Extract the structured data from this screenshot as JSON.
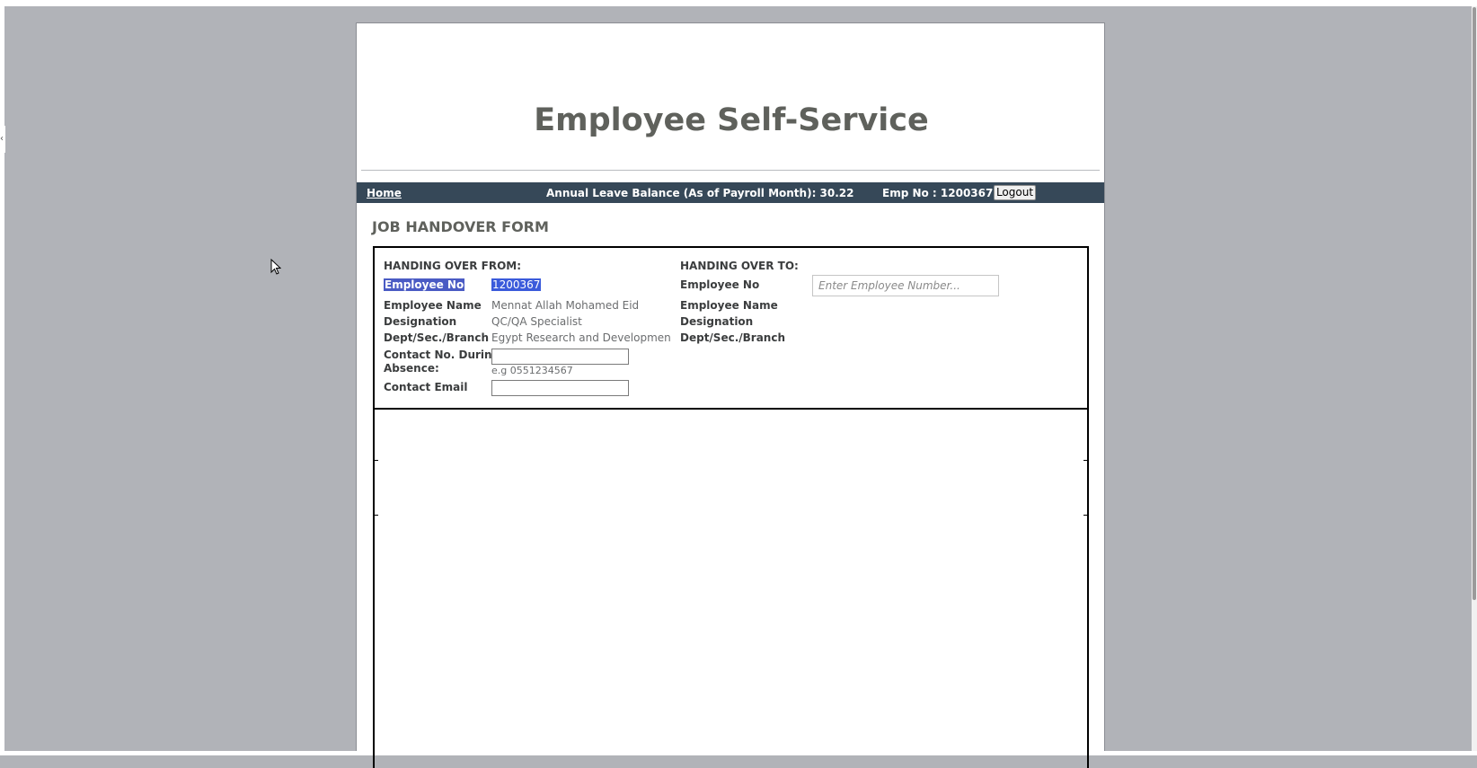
{
  "header": {
    "site_title": "Employee Self-Service"
  },
  "navbar": {
    "home_label": "Home",
    "leave_balance": "Annual Leave Balance (As of Payroll Month): 30.22",
    "emp_no": "Emp No : 1200367",
    "logout_label": "Logout"
  },
  "form": {
    "title": "JOB HANDOVER FORM",
    "from": {
      "heading": "HANDING OVER FROM:",
      "employee_no_label": "Employee No",
      "employee_no_value": "1200367",
      "employee_name_label": "Employee Name",
      "employee_name_value": "Mennat Allah Mohamed Eid",
      "designation_label": "Designation",
      "designation_value": "QC/QA Specialist",
      "dept_label": "Dept/Sec./Branch",
      "dept_value": "Egypt Research and Developmen",
      "contact_label_line1": "Contact No. During",
      "contact_label_line2": "Absence:",
      "contact_value": "",
      "contact_hint": "e.g 0551234567",
      "email_label": "Contact Email",
      "email_value": ""
    },
    "to": {
      "heading": "HANDING OVER TO:",
      "employee_no_label": "Employee No",
      "employee_no_placeholder": "Enter Employee Number...",
      "employee_name_label": "Employee Name",
      "designation_label": "Designation",
      "dept_label": "Dept/Sec./Branch"
    }
  },
  "colors": {
    "background": "#b1b3b8",
    "navbar": "#364858",
    "title": "#5f615c",
    "selection": "#3b5bdb"
  }
}
